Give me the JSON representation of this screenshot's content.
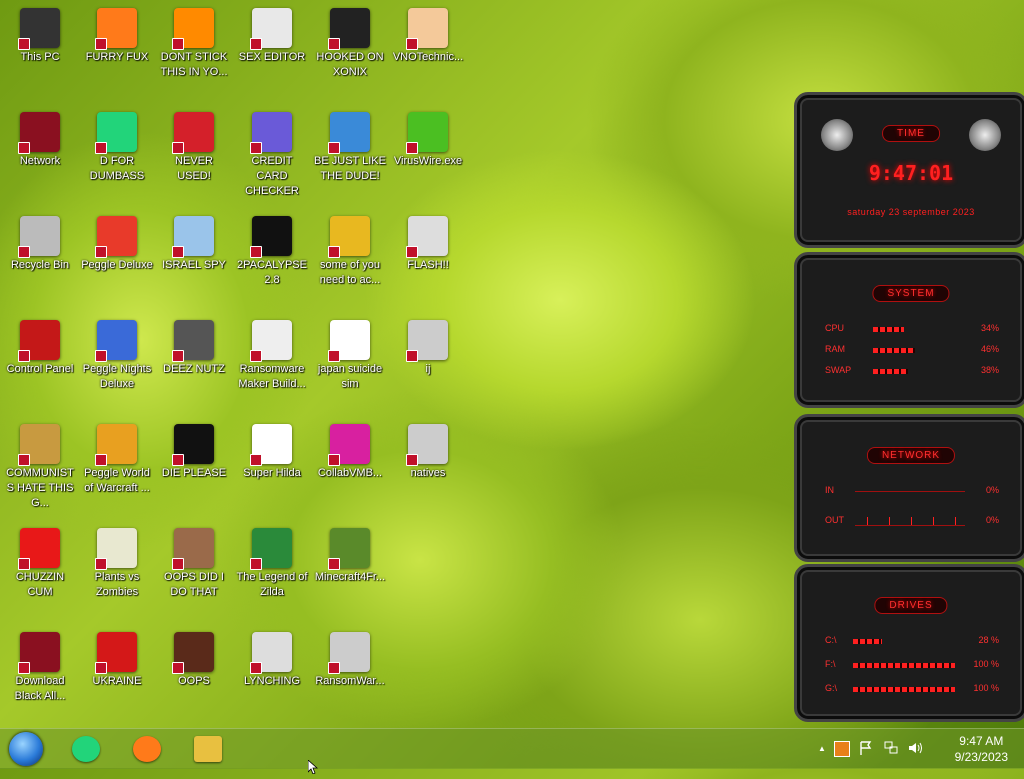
{
  "desktop_icons": [
    {
      "label": "This PC",
      "icon": "monitor-icon",
      "color": "#333"
    },
    {
      "label": "FURRY FUX",
      "icon": "firefox-icon",
      "color": "#ff7a1a"
    },
    {
      "label": "DONT STICK THIS IN YO...",
      "icon": "traffic-cone-icon",
      "color": "#ff8a00"
    },
    {
      "label": "SEX EDITOR",
      "icon": "hxd-icon",
      "color": "#e8e8e8"
    },
    {
      "label": "HOOKED ON XONIX",
      "icon": "xonix-icon",
      "color": "#222"
    },
    {
      "label": "VNOTechnic...",
      "icon": "doctor-icon",
      "color": "#f4c99a"
    },
    {
      "label": "Network",
      "icon": "alien-network-icon",
      "color": "#8a1020"
    },
    {
      "label": "D FOR DUMBASS",
      "icon": "discord-like-icon",
      "color": "#22d47a"
    },
    {
      "label": "NEVER USED!",
      "icon": "dev-cpp-icon",
      "color": "#d4202a"
    },
    {
      "label": "CREDIT CARD CHECKER",
      "icon": "credit-card-icon",
      "color": "#6a5ad8"
    },
    {
      "label": "BE JUST LIKE THE DUDE!",
      "icon": "santa-icon",
      "color": "#3a8ad8"
    },
    {
      "label": "VirusWire.exe",
      "icon": "limewire-icon",
      "color": "#4bbf22"
    },
    {
      "label": "Recycle Bin",
      "icon": "recycle-bin-icon",
      "color": "#bbb"
    },
    {
      "label": "Peggle Deluxe",
      "icon": "peggle-icon",
      "color": "#e83a2a"
    },
    {
      "label": "ISRAEL SPY",
      "icon": "network-spy-icon",
      "color": "#9ac4ea"
    },
    {
      "label": "2PACALYPSE 2.8",
      "icon": "terminal-icon",
      "color": "#111"
    },
    {
      "label": "some of you need to ac...",
      "icon": "dog-icon",
      "color": "#e8b820"
    },
    {
      "label": "FLASH!!",
      "icon": "flash-icon",
      "color": "#ddd"
    },
    {
      "label": "Control Panel",
      "icon": "control-panel-icon",
      "color": "#c41818"
    },
    {
      "label": "Peggle Nights Deluxe",
      "icon": "peggle-nights-icon",
      "color": "#3a6ad8"
    },
    {
      "label": "DEEZ NUTZ",
      "icon": "stacked-windows-icon",
      "color": "#555"
    },
    {
      "label": "Ransomware Maker Build...",
      "icon": "window-app-icon",
      "color": "#eee"
    },
    {
      "label": "japan suicide sim",
      "icon": "japan-sim-icon",
      "color": "#fff"
    },
    {
      "label": "ij",
      "icon": "folder-doc-icon",
      "color": "#ccc"
    },
    {
      "label": "COMMUNISTS HATE THIS G...",
      "icon": "money-bag-icon",
      "color": "#c89a40"
    },
    {
      "label": "Peggle World of Warcraft ...",
      "icon": "peggle-wow-icon",
      "color": "#e8a020"
    },
    {
      "label": "DIE PLEASE",
      "icon": "de-icon",
      "color": "#111"
    },
    {
      "label": "Super Hilda",
      "icon": "pixel-character-icon",
      "color": "#fff"
    },
    {
      "label": "CollabVMB...",
      "icon": "collab-vm-icon",
      "color": "#d820a0"
    },
    {
      "label": "natives",
      "icon": "folder-doc-icon",
      "color": "#ccc"
    },
    {
      "label": "CHUZZIN CUM",
      "icon": "chuzzle-icon",
      "color": "#e81818"
    },
    {
      "label": "Plants vs Zombies",
      "icon": "flower-icon",
      "color": "#e8e8d0"
    },
    {
      "label": "OOPS DID I DO THAT",
      "icon": "portrait-icon",
      "color": "#9a6a4a"
    },
    {
      "label": "The Legend of Zilda",
      "icon": "zilda-icon",
      "color": "#2a8a3a"
    },
    {
      "label": "Minecraft4Fr...",
      "icon": "grass-block-icon",
      "color": "#5a8a2a"
    },
    {
      "label": "Download Black All...",
      "icon": "alien-download-icon",
      "color": "#8a1020"
    },
    {
      "label": "UKRAINE",
      "icon": "radiation-icon",
      "color": "#d41818"
    },
    {
      "label": "OOPS",
      "icon": "book-icon",
      "color": "#5a2a1a"
    },
    {
      "label": "LYNCHING",
      "icon": "noose-icon",
      "color": "#ddd"
    },
    {
      "label": "RansomWar...",
      "icon": "skull-icon",
      "color": "#ccc"
    }
  ],
  "widgets": {
    "time": {
      "title": "TIME",
      "clock": "9:47:01",
      "date": "saturday 23 september 2023"
    },
    "system": {
      "title": "SYSTEM",
      "rows": [
        {
          "key": "CPU",
          "value": "34%",
          "level": 0.34
        },
        {
          "key": "RAM",
          "value": "46%",
          "level": 0.46
        },
        {
          "key": "SWAP",
          "value": "38%",
          "level": 0.38
        }
      ]
    },
    "network": {
      "title": "NETWORK",
      "rows": [
        {
          "key": "IN",
          "value": "0%"
        },
        {
          "key": "OUT",
          "value": "0%"
        }
      ]
    },
    "drives": {
      "title": "DRIVES",
      "rows": [
        {
          "key": "C:\\",
          "value": "28 %",
          "level": 0.28
        },
        {
          "key": "F:\\",
          "value": "100 %",
          "level": 1.0
        },
        {
          "key": "G:\\",
          "value": "100 %",
          "level": 1.0
        }
      ]
    }
  },
  "taskbar": {
    "start_icon": "start-orb-icon",
    "pinned": [
      {
        "name": "taskbar-discord-like",
        "icon": "discord-like-icon",
        "color": "#22d47a"
      },
      {
        "name": "taskbar-firefox",
        "icon": "firefox-icon",
        "color": "#ff7a1a"
      },
      {
        "name": "taskbar-file-explorer",
        "icon": "folder-icon",
        "color": "#e8c040"
      }
    ],
    "tray": {
      "chevron": "▲",
      "time": "9:47 AM",
      "date": "9/23/2023"
    }
  }
}
